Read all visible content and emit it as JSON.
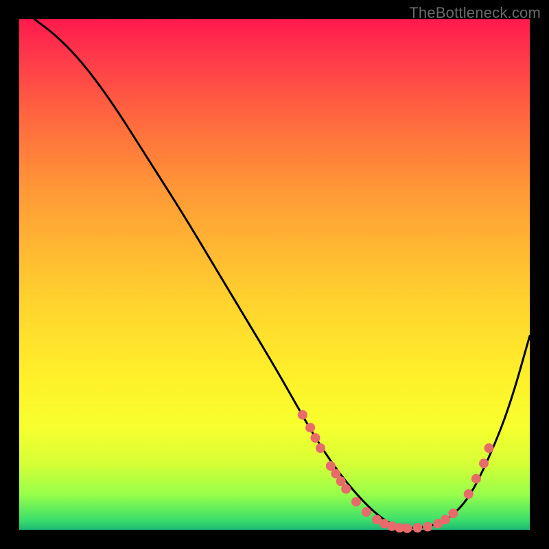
{
  "watermark": "TheBottleneck.com",
  "colors": {
    "dot": "#e86a6a",
    "curve": "#000000",
    "frame_bg_top": "#ff1a4d",
    "frame_bg_bottom": "#1db877",
    "page_bg": "#000000"
  },
  "chart_data": {
    "type": "line",
    "title": "",
    "xlabel": "",
    "ylabel": "",
    "xlim": [
      0,
      100
    ],
    "ylim": [
      0,
      100
    ],
    "grid": false,
    "legend": false,
    "series": [
      {
        "name": "curve",
        "x": [
          3,
          7,
          12,
          18,
          25,
          32,
          38,
          44,
          50,
          54,
          58,
          62,
          66,
          70,
          73,
          76,
          80,
          84,
          88,
          92,
          96,
          100
        ],
        "y": [
          100,
          97,
          92,
          84,
          73,
          62,
          52,
          42,
          32,
          25,
          18,
          12,
          7,
          3,
          1,
          0.3,
          0.5,
          2,
          6,
          14,
          24,
          38
        ]
      }
    ],
    "points": [
      {
        "x": 55.5,
        "y": 22.5
      },
      {
        "x": 57.0,
        "y": 20.0
      },
      {
        "x": 58.0,
        "y": 18.0
      },
      {
        "x": 59.0,
        "y": 16.0
      },
      {
        "x": 61.0,
        "y": 12.5
      },
      {
        "x": 62.0,
        "y": 11.0
      },
      {
        "x": 63.0,
        "y": 9.5
      },
      {
        "x": 64.0,
        "y": 8.0
      },
      {
        "x": 66.0,
        "y": 5.5
      },
      {
        "x": 68.0,
        "y": 3.5
      },
      {
        "x": 70.0,
        "y": 2.0
      },
      {
        "x": 71.5,
        "y": 1.2
      },
      {
        "x": 73.0,
        "y": 0.7
      },
      {
        "x": 74.5,
        "y": 0.4
      },
      {
        "x": 76.0,
        "y": 0.3
      },
      {
        "x": 78.0,
        "y": 0.4
      },
      {
        "x": 80.0,
        "y": 0.6
      },
      {
        "x": 82.0,
        "y": 1.2
      },
      {
        "x": 83.5,
        "y": 2.0
      },
      {
        "x": 85.0,
        "y": 3.2
      },
      {
        "x": 88.0,
        "y": 7.0
      },
      {
        "x": 89.5,
        "y": 10.0
      },
      {
        "x": 91.0,
        "y": 13.0
      },
      {
        "x": 92.0,
        "y": 16.0
      }
    ],
    "point_radius": 7
  }
}
